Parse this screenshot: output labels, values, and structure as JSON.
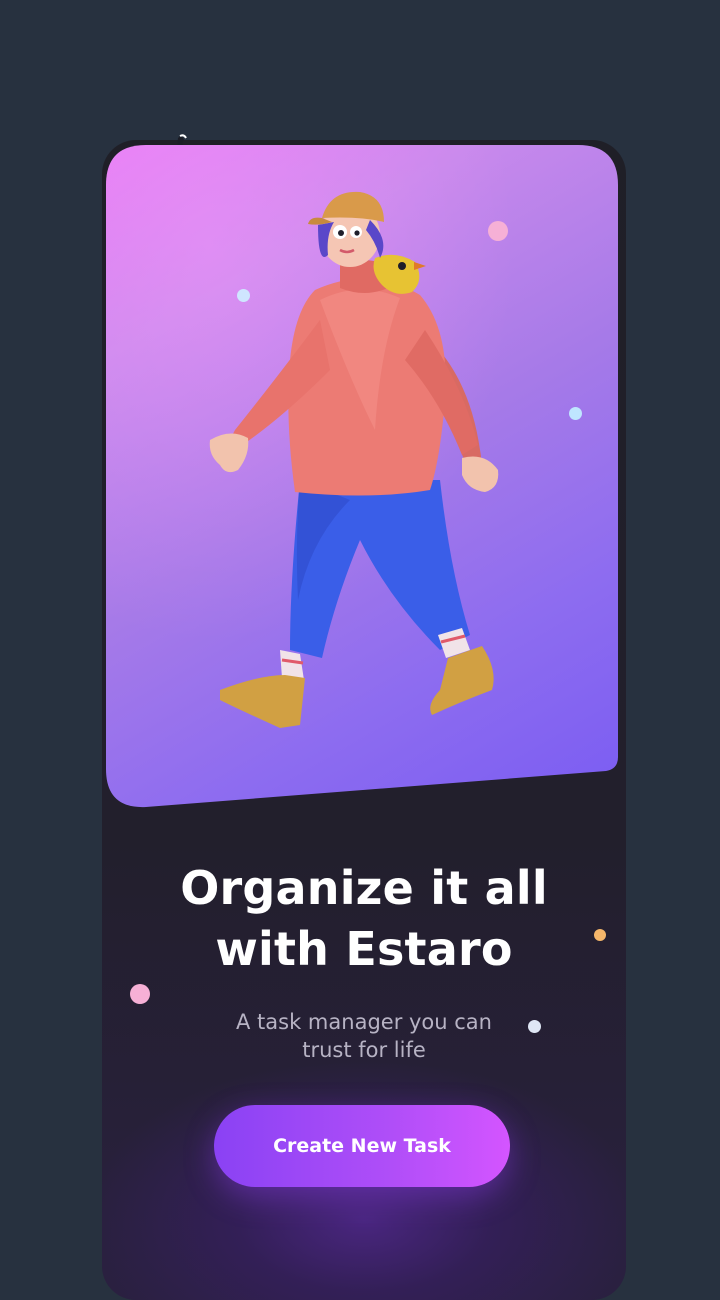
{
  "onboarding": {
    "title_line1": "Organize it all",
    "title_line2": "with Estaro",
    "subtitle_line1": "A task manager you can",
    "subtitle_line2": "trust for life",
    "cta_label": "Create New Task"
  },
  "illustration": {
    "subject": "walking-person-with-bird"
  },
  "colors": {
    "background": "#27313f",
    "card_dark": "#1f1f27",
    "hero_gradient_start": "#e47cf4",
    "hero_gradient_end": "#7a5cf2",
    "cta_gradient_start": "#8a42f4",
    "cta_gradient_end": "#d455ff",
    "title": "#ffffff",
    "subtitle": "#b7b3c4"
  }
}
